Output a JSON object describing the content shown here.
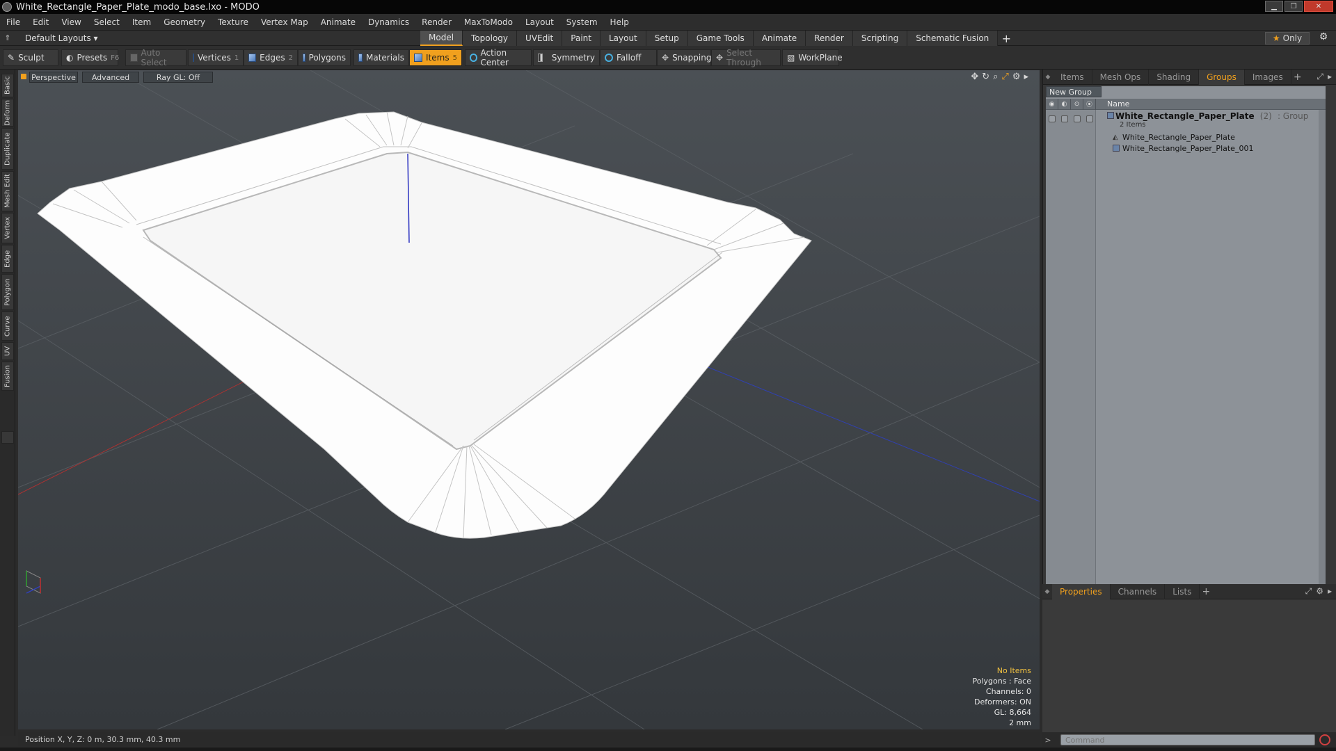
{
  "window": {
    "title": "White_Rectangle_Paper_Plate_modo_base.lxo - MODO"
  },
  "menu": [
    "File",
    "Edit",
    "View",
    "Select",
    "Item",
    "Geometry",
    "Texture",
    "Vertex Map",
    "Animate",
    "Dynamics",
    "Render",
    "MaxToModo",
    "Layout",
    "System",
    "Help"
  ],
  "layouts": {
    "current": "Default Layouts ▾",
    "tabs": [
      "Model",
      "Topology",
      "UVEdit",
      "Paint",
      "Layout",
      "Setup",
      "Game Tools",
      "Animate",
      "Render",
      "Scripting",
      "Schematic Fusion"
    ],
    "active_tab": "Model",
    "only_label": "Only"
  },
  "toolbar": {
    "sculpt": "Sculpt",
    "presets": "Presets",
    "presets_key": "F6",
    "auto_select": "Auto Select",
    "vertices": "Vertices",
    "vertices_key": "1",
    "edges": "Edges",
    "edges_key": "2",
    "polygons": "Polygons",
    "materials": "Materials",
    "items": "Items",
    "items_key": "5",
    "action_center": "Action Center",
    "symmetry": "Symmetry",
    "falloff": "Falloff",
    "snapping": "Snapping",
    "select_through": "Select Through",
    "workplane": "WorkPlane"
  },
  "left_tabs": [
    "Basic",
    "Deform",
    "Duplicate",
    "Mesh Edit",
    "Vertex",
    "Edge",
    "Polygon",
    "Curve",
    "UV",
    "Fusion"
  ],
  "viewport": {
    "view": "Perspective",
    "mode": "Advanced",
    "raygl": "Ray GL: Off",
    "info": {
      "selection": "No Items",
      "polygons": "Polygons : Face",
      "channels": "Channels: 0",
      "deformers": "Deformers: ON",
      "gl": "GL: 8,664",
      "scale": "2 mm"
    }
  },
  "status": {
    "position": "Position X, Y, Z:  0 m, 30.3 mm, 40.3 mm"
  },
  "right_panel": {
    "tabs": [
      "Items",
      "Mesh Ops",
      "Shading",
      "Groups",
      "Images"
    ],
    "active_tab": "Groups",
    "new_group": "New Group",
    "name_header": "Name",
    "group": {
      "name": "White_Rectangle_Paper_Plate",
      "count": "(2)",
      "kind": ": Group",
      "subtitle": "2 Items",
      "children": [
        "White_Rectangle_Paper_Plate",
        "White_Rectangle_Paper_Plate_001"
      ]
    }
  },
  "bottom_panel": {
    "tabs": [
      "Properties",
      "Channels",
      "Lists"
    ],
    "active_tab": "Properties"
  },
  "command": {
    "placeholder": "Command"
  },
  "colors": {
    "accent": "#f0a01e",
    "viewport_bg": "#484d52",
    "plate": "#ffffff"
  }
}
